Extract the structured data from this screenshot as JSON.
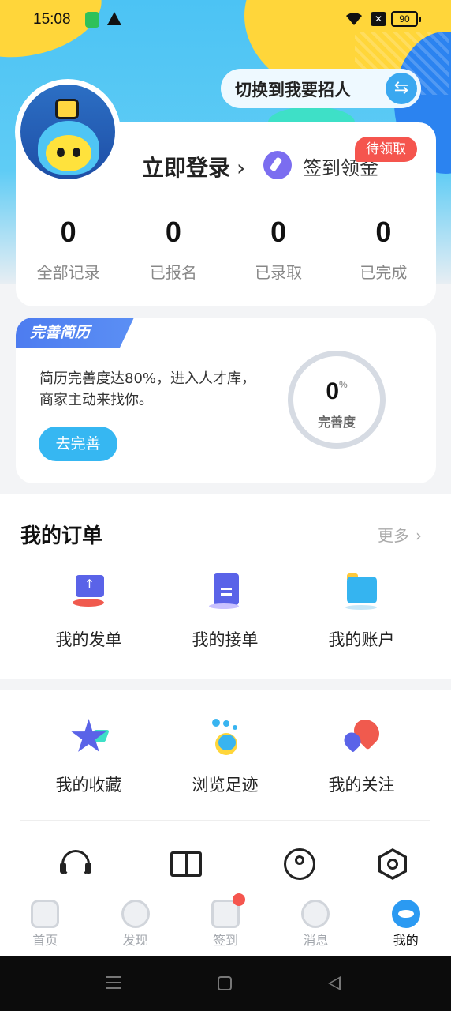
{
  "status_bar": {
    "time": "15:08",
    "battery": "90"
  },
  "switch": {
    "label": "切换到我要招人",
    "icon": "swap-arrows-icon"
  },
  "profile": {
    "login_label": "立即登录",
    "checkin_label": "签到领金",
    "pending_badge": "待领取",
    "stats": [
      {
        "value": "0",
        "label": "全部记录"
      },
      {
        "value": "0",
        "label": "已报名"
      },
      {
        "value": "0",
        "label": "已录取"
      },
      {
        "value": "0",
        "label": "已完成"
      }
    ]
  },
  "resume": {
    "tag": "完善简历",
    "desc_line1": "简历完善度达80%，进入人才库，",
    "desc_line2": "商家主动来找你。",
    "button": "去完善",
    "percent_value": "0",
    "percent_sign": "%",
    "ring_label": "完善度"
  },
  "orders": {
    "title": "我的订单",
    "more": "更多",
    "items": [
      {
        "label": "我的发单",
        "icon": "publish-order-icon"
      },
      {
        "label": "我的接单",
        "icon": "accept-order-icon"
      },
      {
        "label": "我的账户",
        "icon": "account-folder-icon"
      }
    ]
  },
  "tools": {
    "items": [
      {
        "label": "我的收藏",
        "icon": "star-favorite-icon"
      },
      {
        "label": "浏览足迹",
        "icon": "footprint-icon"
      },
      {
        "label": "我的关注",
        "icon": "heart-follow-icon"
      }
    ],
    "line_icons": [
      "headset-icon",
      "book-icon",
      "user-circle-icon",
      "settings-hex-icon"
    ]
  },
  "tabbar": {
    "tabs": [
      {
        "label": "首页",
        "icon": "home-icon"
      },
      {
        "label": "发现",
        "icon": "discover-icon"
      },
      {
        "label": "签到",
        "icon": "calendar-check-icon"
      },
      {
        "label": "消息",
        "icon": "message-icon"
      },
      {
        "label": "我的",
        "icon": "mine-icon"
      }
    ],
    "active": "我的"
  },
  "colors": {
    "accent": "#36b7f2",
    "brand_purple": "#5a63e8",
    "badge_red": "#f5554e"
  }
}
